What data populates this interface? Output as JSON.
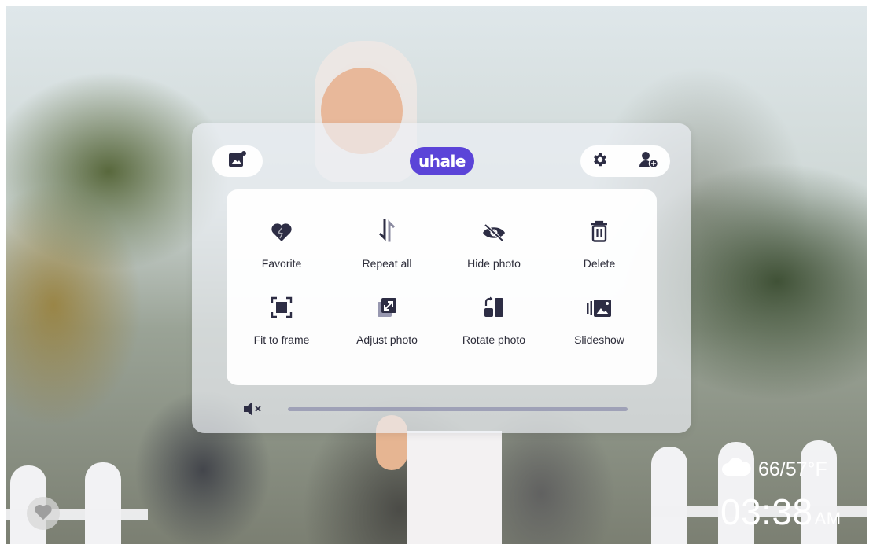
{
  "app": {
    "logo_text": "uhale"
  },
  "menu": {
    "items": [
      {
        "label": "Favorite",
        "icon": "heart-icon"
      },
      {
        "label": "Repeat all",
        "icon": "repeat-all-icon"
      },
      {
        "label": "Hide photo",
        "icon": "eye-off-icon"
      },
      {
        "label": "Delete",
        "icon": "trash-icon"
      },
      {
        "label": "Fit to frame",
        "icon": "fit-frame-icon"
      },
      {
        "label": "Adjust photo",
        "icon": "adjust-photo-icon"
      },
      {
        "label": "Rotate photo",
        "icon": "rotate-icon"
      },
      {
        "label": "Slideshow",
        "icon": "slideshow-icon"
      }
    ]
  },
  "toolbar": {
    "gallery_icon": "gallery-icon",
    "settings_icon": "gear-icon",
    "add_user_icon": "add-user-icon"
  },
  "volume": {
    "muted": true,
    "icon": "volume-mute-icon",
    "level": 0
  },
  "weather": {
    "icon": "cloud-icon",
    "temperature": "66/57°F"
  },
  "clock": {
    "time": "03:38",
    "ampm": "AM"
  },
  "colors": {
    "accent": "#5b44d8",
    "icon_dark": "#2d2d44",
    "panel": "#eef0f6"
  }
}
